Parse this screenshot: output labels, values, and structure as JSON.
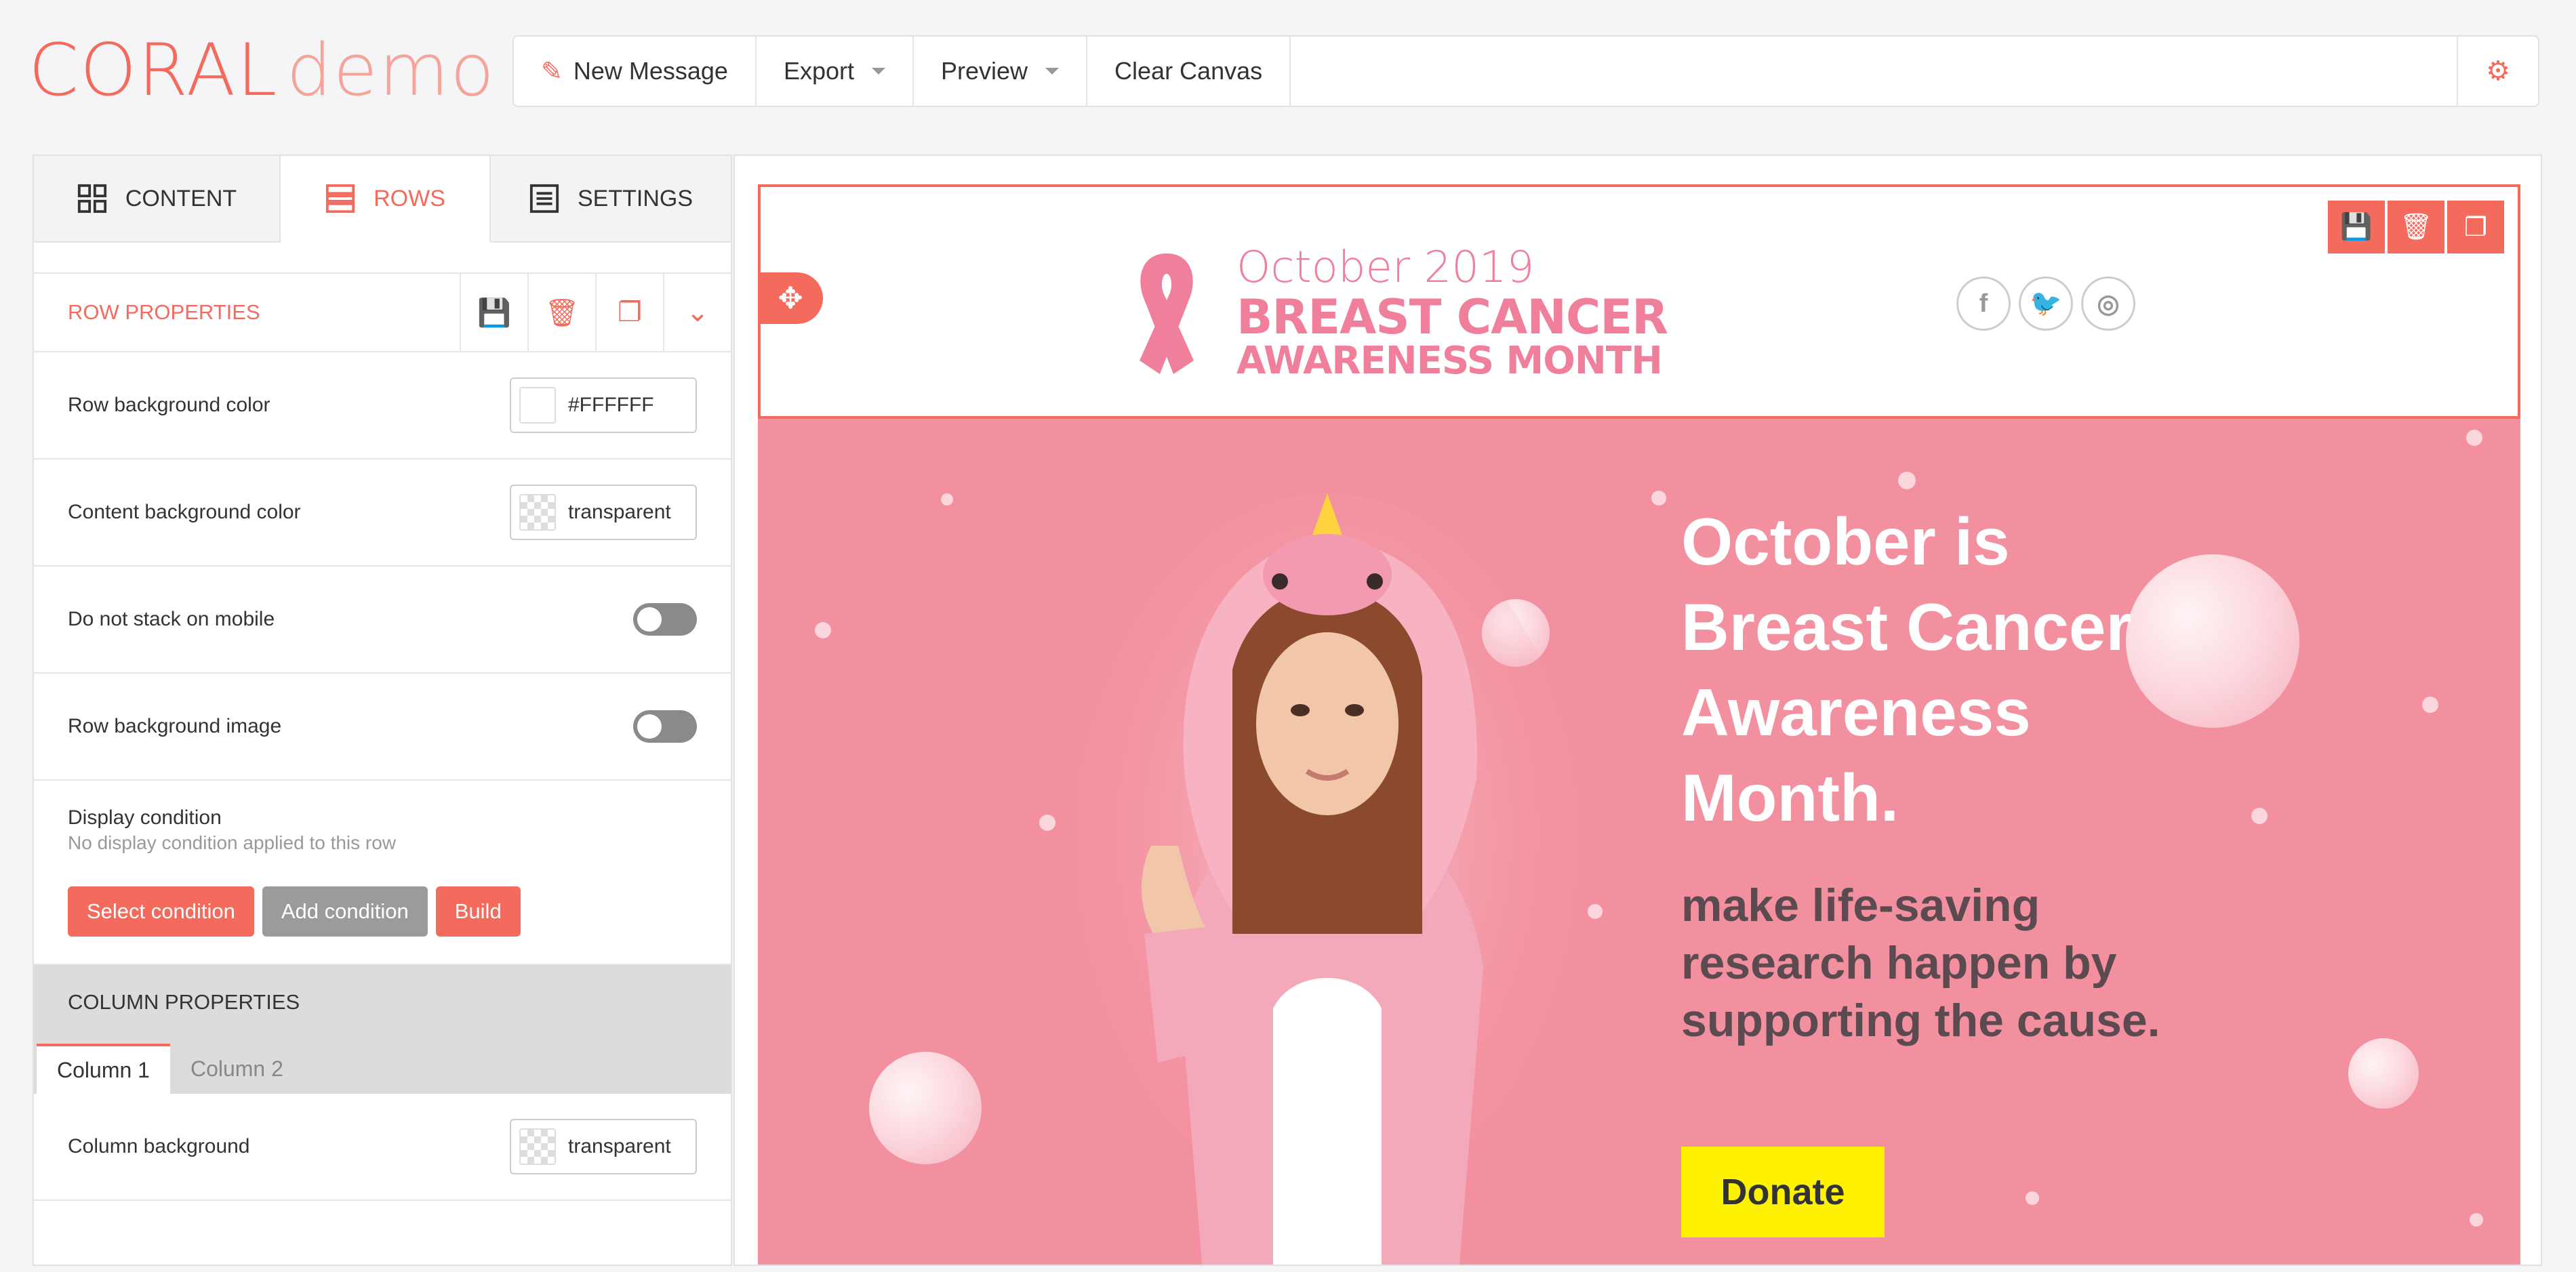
{
  "app": {
    "logo_main": "CORAL",
    "logo_sub": "demo"
  },
  "toolbar": {
    "new_message": "New Message",
    "export": "Export",
    "preview": "Preview",
    "clear_canvas": "Clear Canvas"
  },
  "tabs": [
    {
      "label": "CONTENT",
      "icon": "grid-icon"
    },
    {
      "label": "ROWS",
      "icon": "rows-icon",
      "active": true
    },
    {
      "label": "SETTINGS",
      "icon": "settings-list-icon"
    }
  ],
  "row_properties": {
    "title": "ROW PROPERTIES",
    "row_bg_label": "Row background color",
    "row_bg_value": "#FFFFFF",
    "content_bg_label": "Content background color",
    "content_bg_value": "transparent",
    "no_stack_label": "Do not stack on mobile",
    "no_stack_on": false,
    "bg_image_label": "Row background image",
    "bg_image_on": false,
    "display_condition_label": "Display condition",
    "display_condition_sub": "No display condition applied to this row",
    "select_condition": "Select condition",
    "add_condition": "Add condition",
    "build": "Build"
  },
  "column_properties": {
    "title": "COLUMN PROPERTIES",
    "tabs": [
      "Column 1",
      "Column 2"
    ],
    "column_bg_label": "Column background",
    "column_bg_value": "transparent"
  },
  "email": {
    "brand_line1": "October 2019",
    "brand_line2": "BREAST CANCER",
    "brand_line3": "AWARENESS MONTH",
    "hero_title": "October is Breast Cancer Awareness Month.",
    "hero_sub": "make life-saving research happen by supporting the cause.",
    "donate": "Donate"
  },
  "colors": {
    "accent": "#f46b5d",
    "hero_bg": "#f3909f",
    "donate_bg": "#fff200",
    "brand_pink": "#f07f9b"
  }
}
